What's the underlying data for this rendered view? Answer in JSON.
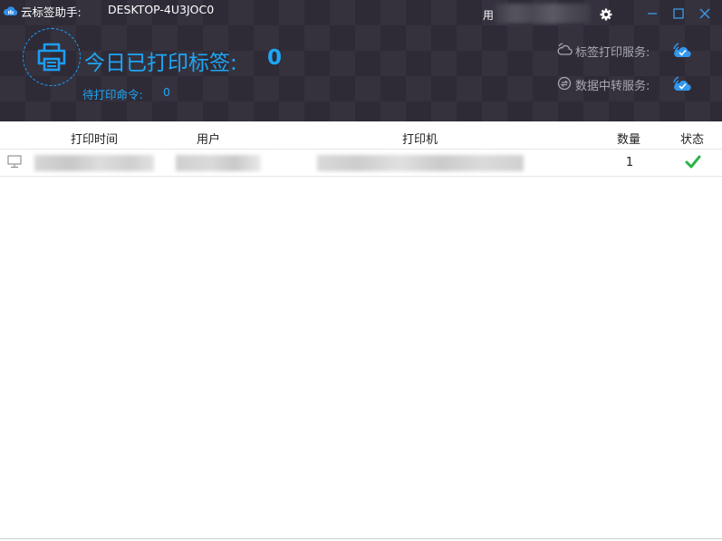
{
  "app": {
    "title": "云标签助手:",
    "host": "DESKTOP-4U3JOC0",
    "user_prefix": "用"
  },
  "window_controls": {
    "settings_icon": "gear-icon",
    "minimize_icon": "minimize-icon",
    "maximize_icon": "maximize-icon",
    "close_icon": "close-icon"
  },
  "stats": {
    "today_label": "今日已打印标签:",
    "today_count": "0",
    "pending_label": "待打印命令:",
    "pending_count": "0"
  },
  "services": [
    {
      "label": "标签打印服务:",
      "icon": "cloud-icon",
      "status_icon": "cloud-connected-icon"
    },
    {
      "label": "数据中转服务:",
      "icon": "sync-icon",
      "status_icon": "cloud-connected-icon"
    }
  ],
  "table": {
    "columns": [
      "打印时间",
      "用户",
      "打印机",
      "数量",
      "状态"
    ],
    "rows": [
      {
        "quantity": "1",
        "status_icon": "check-icon"
      }
    ]
  },
  "colors": {
    "header_bg": "#2e2b37",
    "accent": "#1ea6f5",
    "success": "#2cb34a"
  }
}
